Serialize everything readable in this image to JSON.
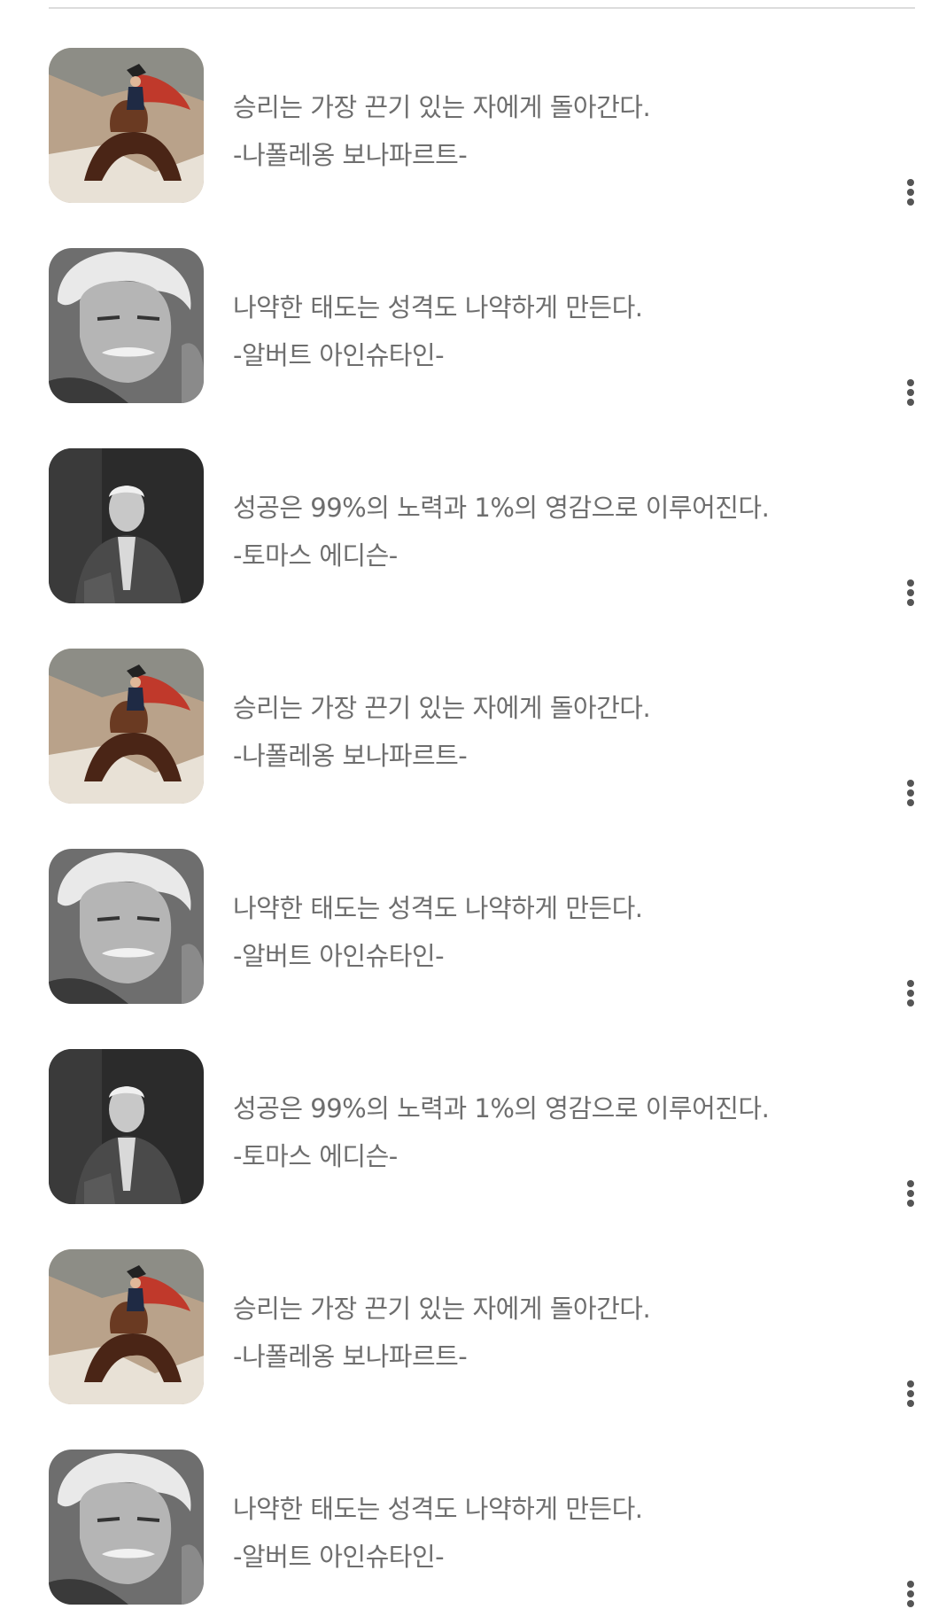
{
  "quotes": [
    {
      "text": "승리는 가장 끈기 있는 자에게 돌아간다.",
      "author": "-나폴레옹 보나파르트-",
      "portrait": "napoleon"
    },
    {
      "text": "나약한 태도는 성격도 나약하게 만든다.",
      "author": "-알버트 아인슈타인-",
      "portrait": "einstein"
    },
    {
      "text": "성공은 99%의 노력과 1%의 영감으로 이루어진다.",
      "author": "-토마스 에디슨-",
      "portrait": "edison"
    },
    {
      "text": "승리는 가장 끈기 있는 자에게 돌아간다.",
      "author": "-나폴레옹 보나파르트-",
      "portrait": "napoleon"
    },
    {
      "text": "나약한 태도는 성격도 나약하게 만든다.",
      "author": "-알버트 아인슈타인-",
      "portrait": "einstein"
    },
    {
      "text": "성공은 99%의 노력과 1%의 영감으로 이루어진다.",
      "author": "-토마스 에디슨-",
      "portrait": "edison"
    },
    {
      "text": "승리는 가장 끈기 있는 자에게 돌아간다.",
      "author": "-나폴레옹 보나파르트-",
      "portrait": "napoleon"
    },
    {
      "text": "나약한 태도는 성격도 나약하게 만든다.",
      "author": "-알버트 아인슈타인-",
      "portrait": "einstein"
    }
  ],
  "icons": {
    "more": "more-vertical-icon"
  },
  "colors": {
    "text": "#6e6e6e",
    "divider": "#dcdcdc",
    "more_icon": "#555555"
  }
}
